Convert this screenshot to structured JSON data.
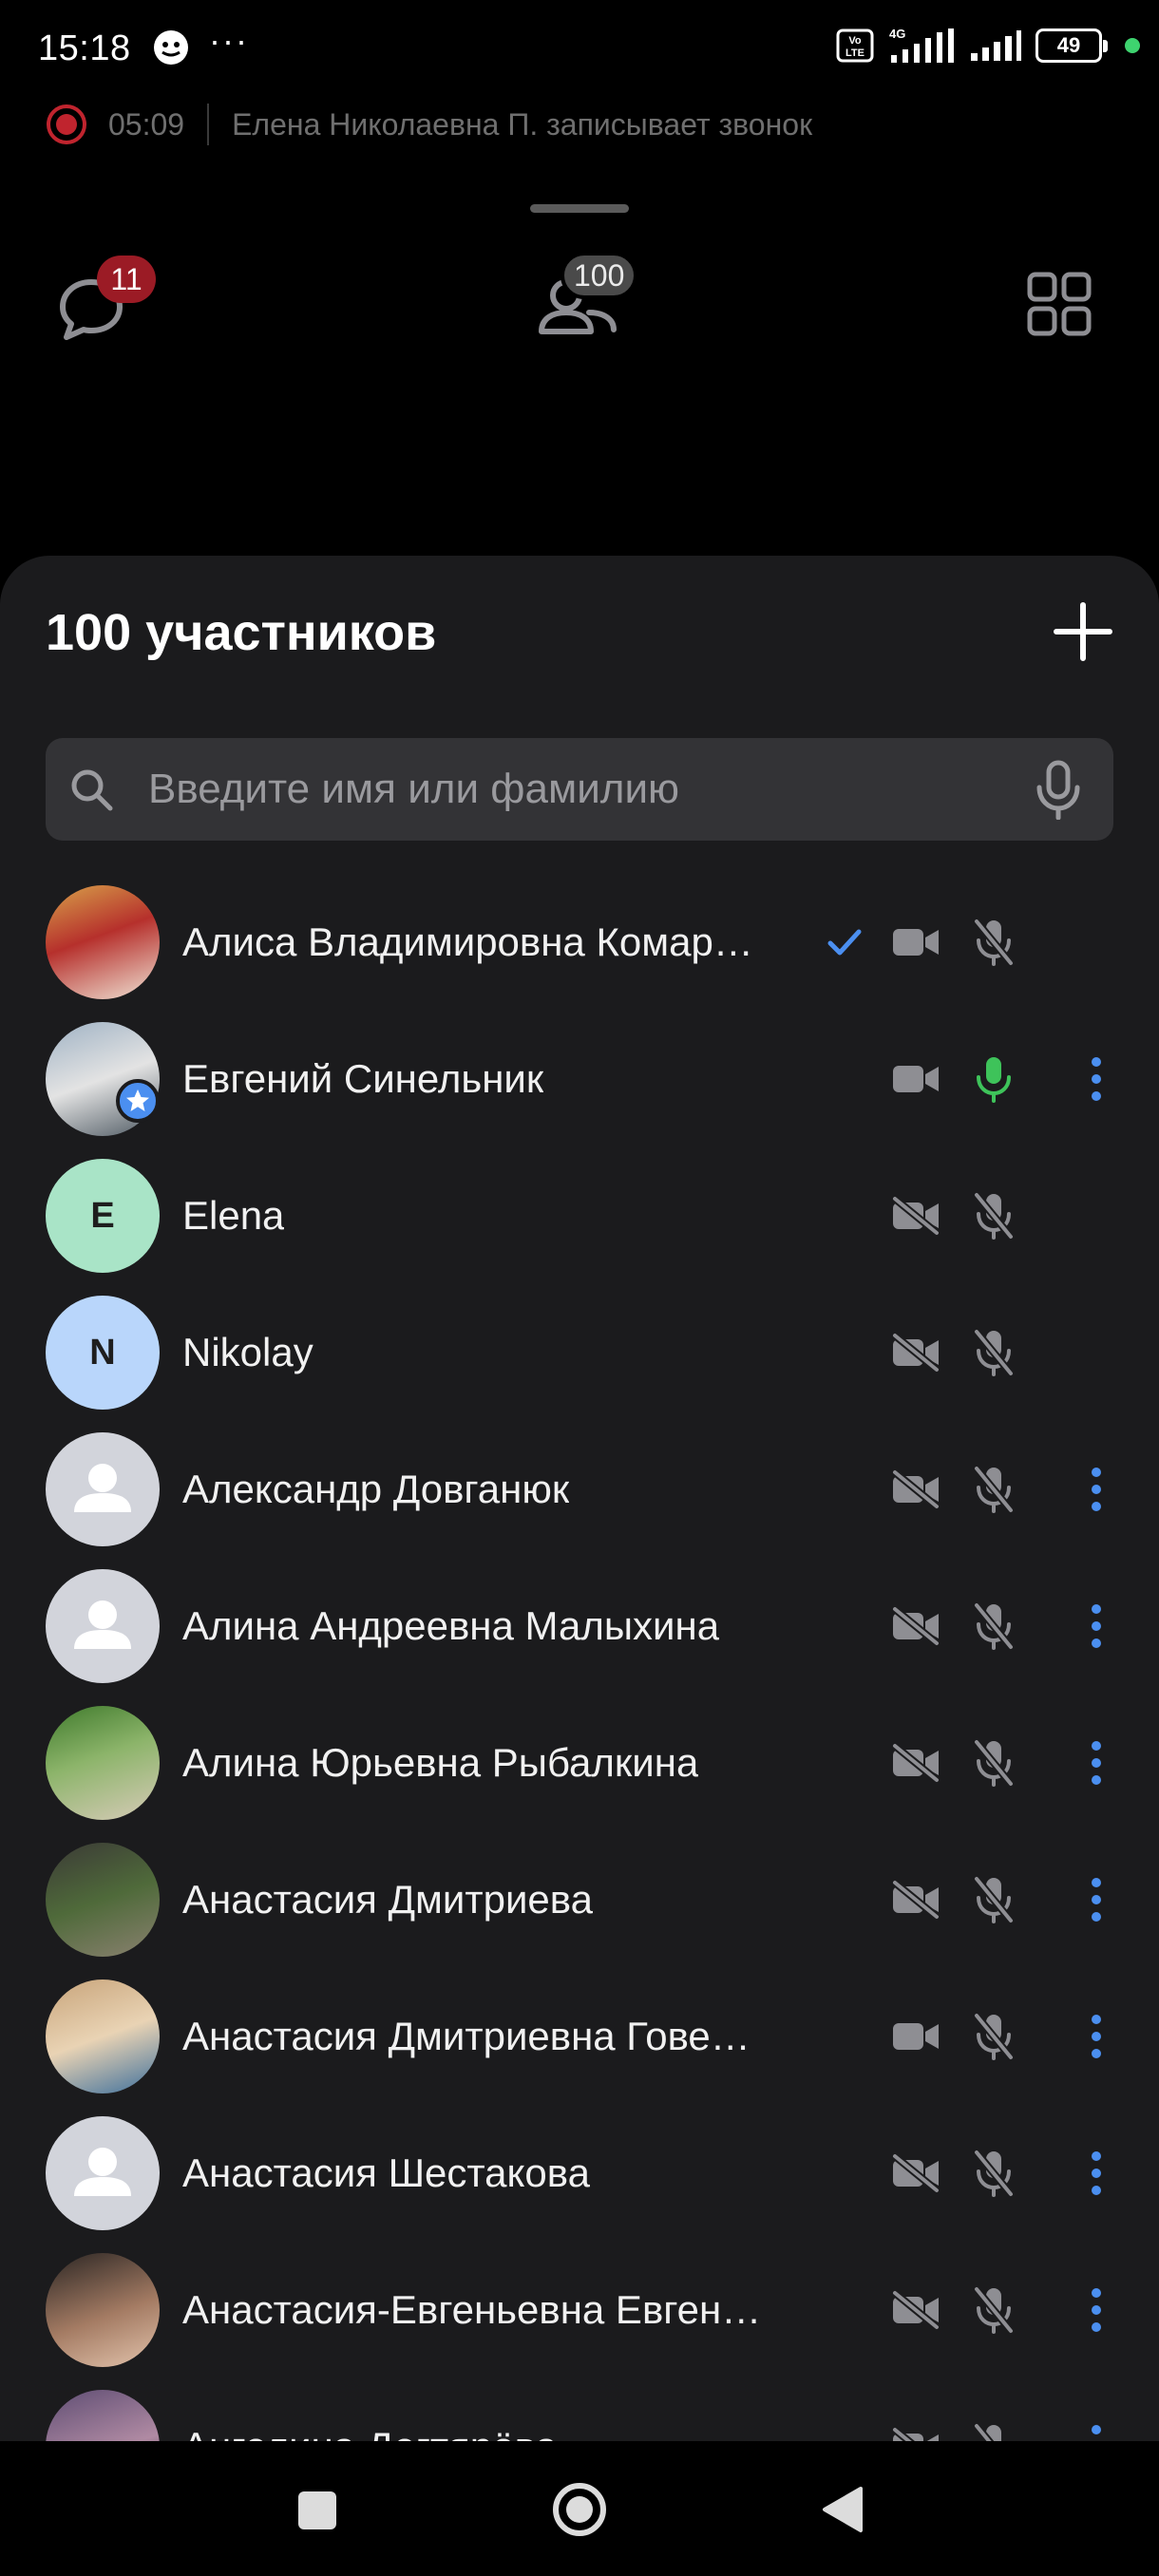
{
  "status_bar": {
    "time": "15:18",
    "more": "···",
    "volte": "Vo LTE",
    "network": "4G",
    "battery": "49"
  },
  "recording": {
    "duration": "05:09",
    "text": "Елена Николаевна П. записывает звонок",
    "color": "#c0242e"
  },
  "controls": {
    "chat_badge": "11",
    "participants_badge": "100"
  },
  "sheet": {
    "title": "100 участников",
    "search_placeholder": "Введите имя или фамилию"
  },
  "colors": {
    "accent": "#4b8ff0",
    "mic_on": "#3ec35a",
    "icon_gray": "#8e8e93",
    "sheet_bg": "#1b1b1d"
  },
  "participants": [
    {
      "name": "Алиса Владимировна Комар…",
      "avatar": "photo",
      "checked": true,
      "camera": "on",
      "mic": "off",
      "menu": false
    },
    {
      "name": "Евгений Синельник",
      "avatar": "photo",
      "admin": true,
      "checked": false,
      "camera": "on",
      "mic": "on",
      "menu": true
    },
    {
      "name": "Elena",
      "avatar": "initial",
      "initial": "E",
      "avatar_color": "#a9e4c7",
      "camera": "off",
      "mic": "off",
      "menu": false
    },
    {
      "name": "Nikolay",
      "avatar": "initial",
      "initial": "N",
      "avatar_color": "#b9d6fb",
      "camera": "off",
      "mic": "off",
      "menu": false
    },
    {
      "name": "Александр Довганюк",
      "avatar": "placeholder",
      "camera": "off",
      "mic": "off",
      "menu": true
    },
    {
      "name": "Алина Андреевна Малыхина",
      "avatar": "placeholder",
      "camera": "off",
      "mic": "off",
      "menu": true
    },
    {
      "name": "Алина Юрьевна  Рыбалкина",
      "avatar": "photo",
      "camera": "off",
      "mic": "off",
      "menu": true
    },
    {
      "name": "Анастасия Дмитриева",
      "avatar": "photo",
      "camera": "off",
      "mic": "off",
      "menu": true
    },
    {
      "name": "Анастасия Дмитриевна Гове…",
      "avatar": "photo",
      "camera": "on",
      "mic": "off",
      "menu": true
    },
    {
      "name": "Анастасия Шестакова",
      "avatar": "placeholder",
      "camera": "off",
      "mic": "off",
      "menu": true
    },
    {
      "name": "Анастасия-Евгеньевна Евген…",
      "avatar": "photo",
      "camera": "off",
      "mic": "off",
      "menu": true
    },
    {
      "name": "Ангелина Дегтярёва",
      "avatar": "photo",
      "camera": "off",
      "mic": "off",
      "menu": true
    }
  ]
}
